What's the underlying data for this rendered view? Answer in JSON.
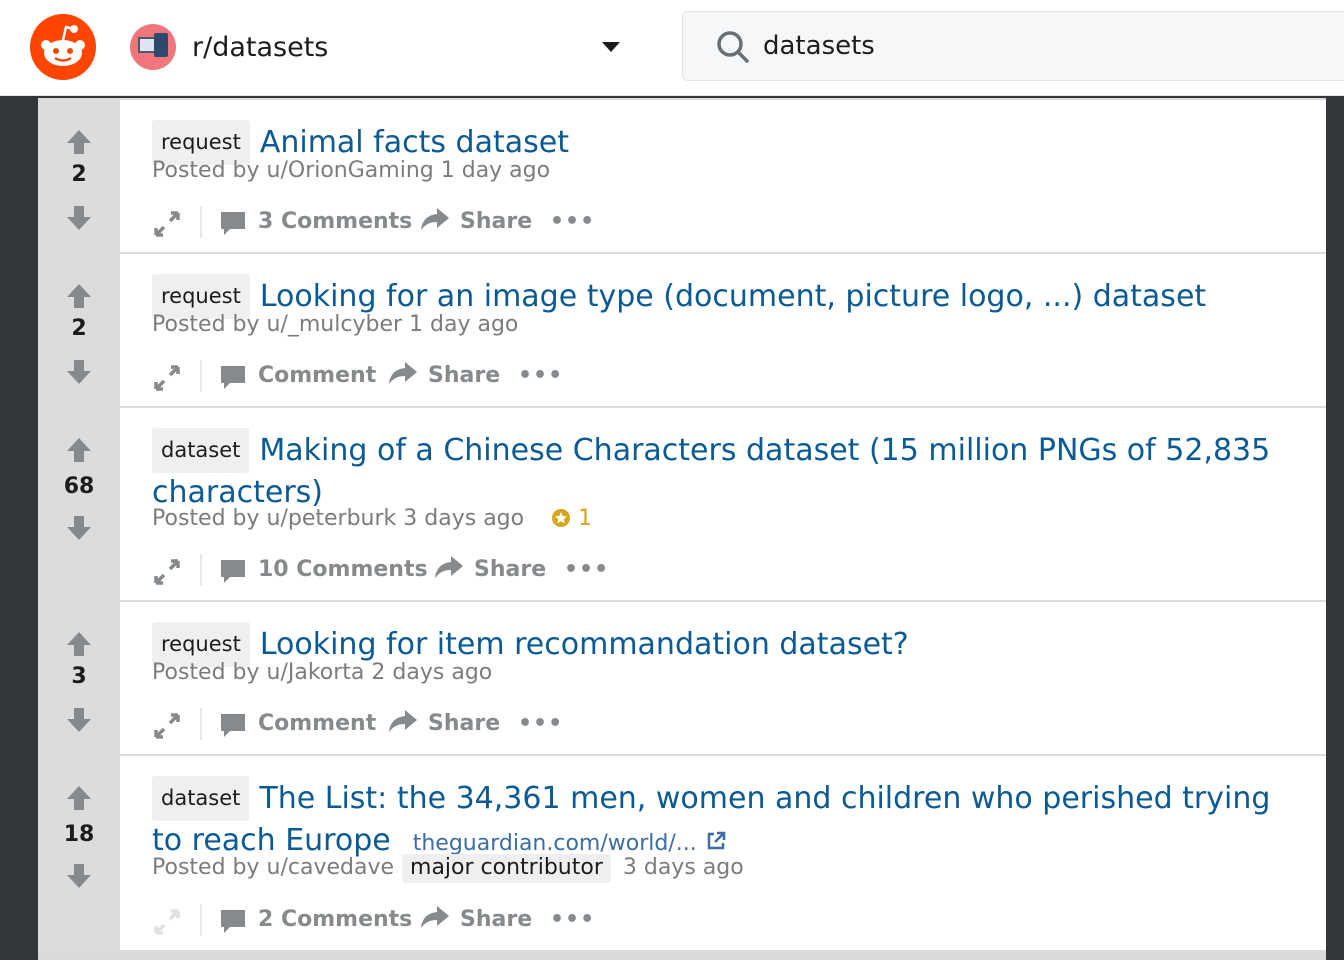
{
  "header": {
    "subreddit": "r/datasets",
    "search_value": "datasets"
  },
  "posts": [
    {
      "score": "2",
      "flair": "request",
      "title": "Animal facts dataset",
      "posted_by_prefix": "Posted by",
      "user": "u/OrionGaming",
      "time": "1 day ago",
      "comments": "3 Comments",
      "share": "Share",
      "more": "•••"
    },
    {
      "score": "2",
      "flair": "request",
      "title": "Looking for an image type (document, picture logo, ...) dataset",
      "posted_by_prefix": "Posted by",
      "user": "u/_mulcyber",
      "time": "1 day ago",
      "comments": "Comment",
      "share": "Share",
      "more": "•••"
    },
    {
      "score": "68",
      "flair": "dataset",
      "title": "Making of a Chinese Characters dataset (15 million PNGs of 52,835 characters)",
      "posted_by_prefix": "Posted by",
      "user": "u/peterburk",
      "time": "3 days ago",
      "award_count": "1",
      "comments": "10 Comments",
      "share": "Share",
      "more": "•••"
    },
    {
      "score": "3",
      "flair": "request",
      "title": "Looking for item recommandation dataset?",
      "posted_by_prefix": "Posted by",
      "user": "u/Jakorta",
      "time": "2 days ago",
      "comments": "Comment",
      "share": "Share",
      "more": "•••"
    },
    {
      "score": "18",
      "flair": "dataset",
      "title": "The List: the 34,361 men, women and children who perished trying to reach Europe",
      "domain": "theguardian.com/world/...",
      "posted_by_prefix": "Posted by",
      "user": "u/cavedave",
      "user_flair": "major contributor",
      "time": "3 days ago",
      "comments": "2 Comments",
      "share": "Share",
      "more": "•••"
    }
  ],
  "colors": {
    "brand": "#ff4500",
    "title": "#0b5a94",
    "meta": "#7c7c7c",
    "award": "#d4a71a"
  }
}
